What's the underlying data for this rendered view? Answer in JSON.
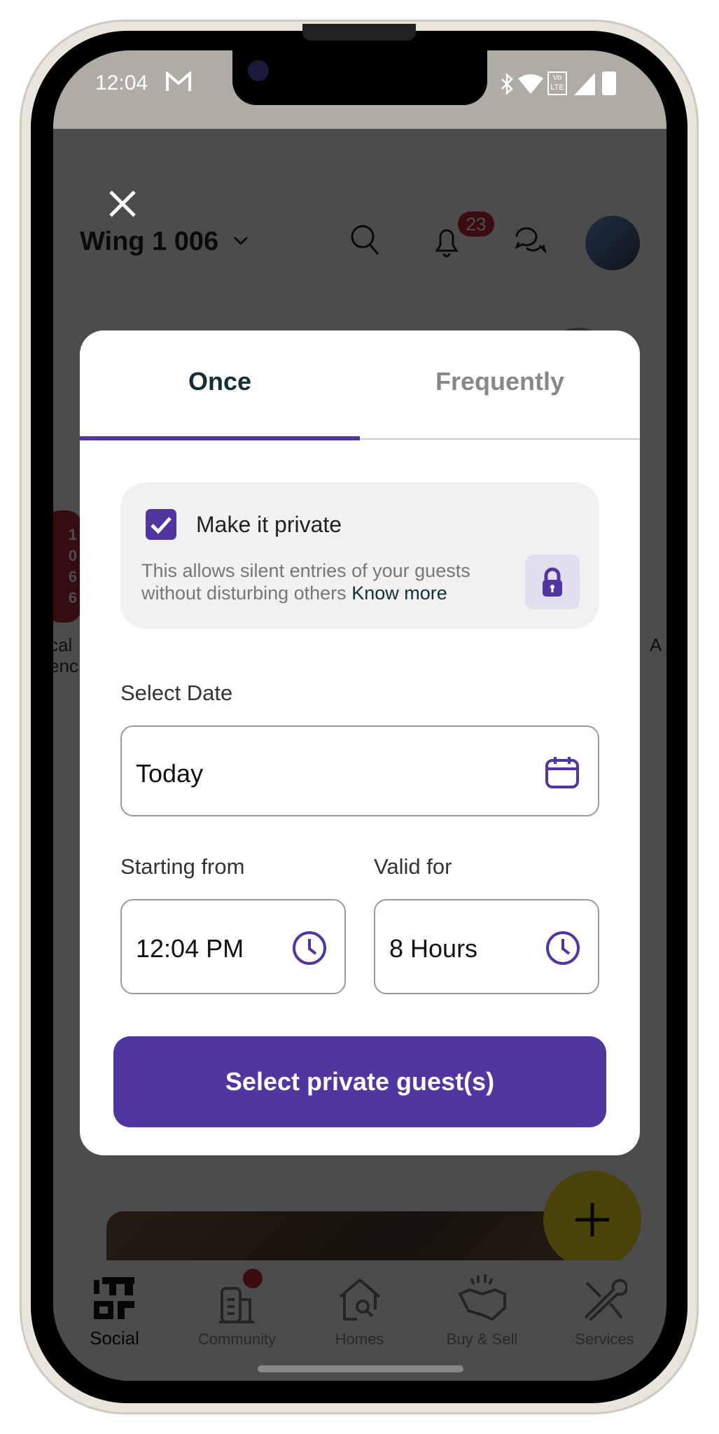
{
  "status_bar": {
    "time": "12:04",
    "notification_icon": "gmail-icon",
    "right_icons": [
      "bluetooth-icon",
      "wifi-icon",
      "volte-icon",
      "signal-icon",
      "battery-icon"
    ],
    "volte_label": "Vo LTE"
  },
  "header": {
    "title": "Wing 1 006",
    "notification_count": "23"
  },
  "background": {
    "side_left_badge": [
      "1",
      "0",
      "6",
      "6"
    ],
    "side_left_label": [
      "cal",
      "enc"
    ],
    "side_right_label": "A"
  },
  "modal": {
    "tabs": [
      {
        "label": "Once",
        "active": true
      },
      {
        "label": "Frequently",
        "active": false
      }
    ],
    "private": {
      "checked": true,
      "label": "Make it private",
      "description": "This allows silent entries of your guests without disturbing others",
      "link": "Know more"
    },
    "date": {
      "label": "Select Date",
      "value": "Today"
    },
    "start": {
      "label": "Starting from",
      "value": "12:04 PM"
    },
    "valid": {
      "label": "Valid for",
      "value": "8 Hours"
    },
    "cta": "Select private guest(s)"
  },
  "bottom_nav": [
    {
      "label": "Social",
      "icon": "social-icon",
      "active": true
    },
    {
      "label": "Community",
      "icon": "building-icon",
      "active": false,
      "dot": true
    },
    {
      "label": "Homes",
      "icon": "home-search-icon",
      "active": false
    },
    {
      "label": "Buy & Sell",
      "icon": "handshake-icon",
      "active": false
    },
    {
      "label": "Services",
      "icon": "tools-icon",
      "active": false
    }
  ],
  "colors": {
    "accent": "#5236a0",
    "fab": "#f3dc1f",
    "badge": "#c0303a",
    "overlay": "rgba(0,0,0,0.72)"
  }
}
